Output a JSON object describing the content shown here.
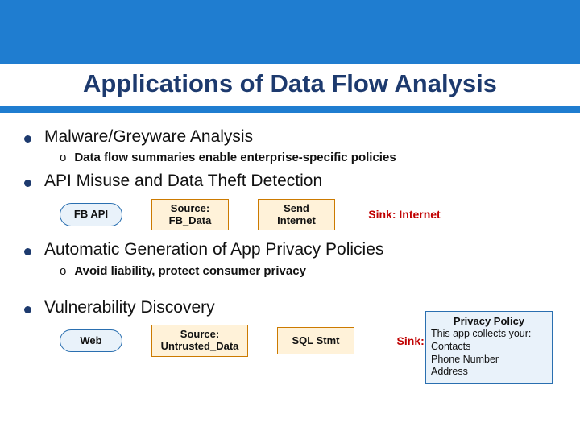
{
  "title": "Applications of Data Flow Analysis",
  "items": [
    {
      "text": "Malware/Greyware Analysis",
      "sub": "Data flow summaries enable enterprise-specific policies"
    },
    {
      "text": "API Misuse and Data Theft Detection",
      "flow": {
        "n0": "FB API",
        "n1": "Source:\nFB_Data",
        "n2": "Send\nInternet",
        "n3": "Sink: Internet"
      }
    },
    {
      "text": "Automatic Generation of App Privacy Policies",
      "sub": "Avoid liability, protect consumer privacy"
    },
    {
      "text": "Vulnerability Discovery",
      "flow": {
        "n0": "Web",
        "n1": "Source:\nUntrusted_Data",
        "n2": "SQL Stmt",
        "n3": "Sink: SQL"
      }
    }
  ],
  "privacy_policy": {
    "title": "Privacy Policy",
    "line0": "This app collects your:",
    "line1": "Contacts",
    "line2": "Phone Number",
    "line3": "Address"
  },
  "submark": "o"
}
